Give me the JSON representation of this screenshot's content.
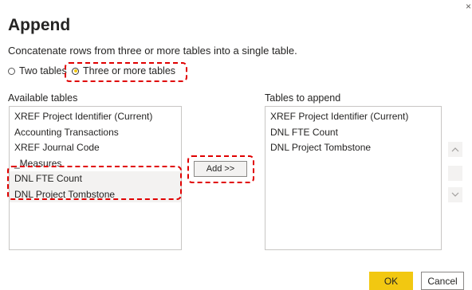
{
  "dialog": {
    "close_glyph": "×",
    "title": "Append",
    "description": "Concatenate rows from three or more tables into a single table."
  },
  "mode": {
    "options": [
      {
        "label": "Two tables",
        "selected": false
      },
      {
        "label": "Three or more tables",
        "selected": true
      }
    ]
  },
  "available": {
    "label": "Available tables",
    "items": [
      "XREF Project Identifier (Current)",
      "Accounting Transactions",
      "XREF Journal Code",
      "_Measures",
      "DNL FTE Count",
      "DNL Project Tombstone"
    ]
  },
  "add_button": {
    "label": "Add >>"
  },
  "append": {
    "label": "Tables to append",
    "items": [
      "XREF Project Identifier (Current)",
      "DNL FTE Count",
      "DNL Project Tombstone"
    ]
  },
  "footer": {
    "ok_label": "OK",
    "cancel_label": "Cancel"
  },
  "colors": {
    "accent": "#f2c811",
    "highlight": "#e00000"
  }
}
